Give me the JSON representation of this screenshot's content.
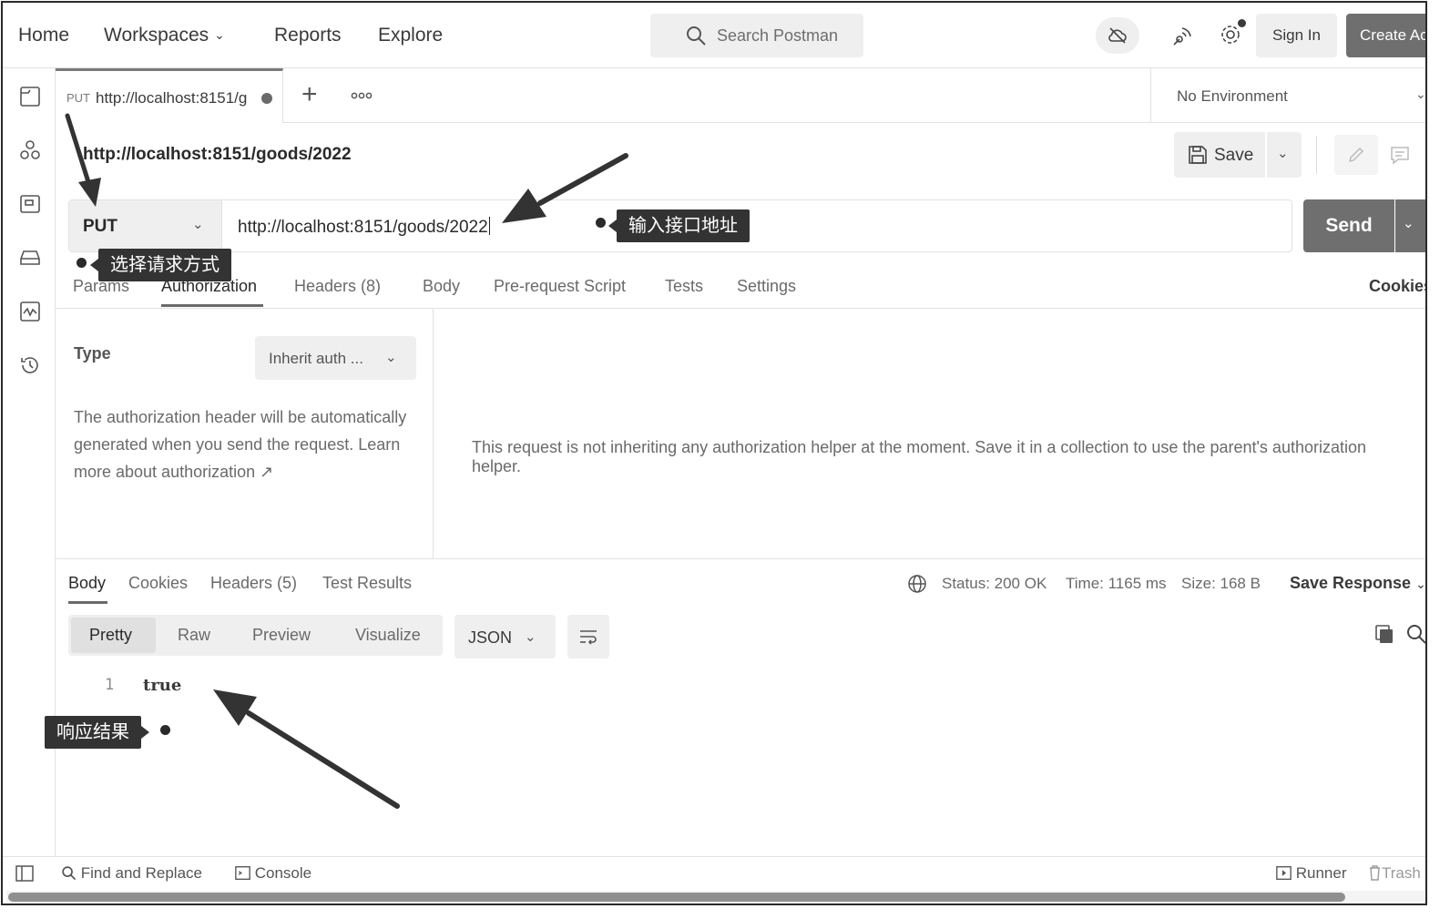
{
  "nav": {
    "home": "Home",
    "workspaces": "Workspaces",
    "reports": "Reports",
    "explore": "Explore",
    "search_placeholder": "Search Postman",
    "sign_in": "Sign In",
    "create_account": "Create Ac"
  },
  "tab": {
    "method": "PUT",
    "url": "http://localhost:8151/g"
  },
  "environment": "No Environment",
  "request": {
    "title": "http://localhost:8151/goods/2022",
    "save": "Save",
    "method": "PUT",
    "url": "http://localhost:8151/goods/2022",
    "send": "Send"
  },
  "request_tabs": [
    "Params",
    "Authorization",
    "Headers (8)",
    "Body",
    "Pre-request Script",
    "Tests",
    "Settings"
  ],
  "cookies": "Cookies",
  "auth": {
    "type_label": "Type",
    "type_value": "Inherit auth ...",
    "description": "The authorization header will be automatically generated when you send the request. Learn more about authorization ↗",
    "message": "This request is not inheriting any authorization helper at the moment. Save it in a collection to use the parent's authorization helper."
  },
  "response": {
    "tabs": [
      "Body",
      "Cookies",
      "Headers (5)",
      "Test Results"
    ],
    "status": "Status: 200 OK",
    "time": "Time: 1165 ms",
    "size": "Size: 168 B",
    "save_response": "Save Response",
    "views": [
      "Pretty",
      "Raw",
      "Preview",
      "Visualize"
    ],
    "format": "JSON",
    "line_number": "1",
    "body": "true"
  },
  "statusbar": {
    "find_replace": "Find and Replace",
    "console": "Console",
    "runner": "Runner",
    "trash": "Trash"
  },
  "annotations": {
    "method_hint": "选择请求方式",
    "url_hint": "输入接口地址",
    "result_hint": "响应结果"
  },
  "colors": {
    "accent": "#6f6f6f",
    "callout": "#333333"
  }
}
